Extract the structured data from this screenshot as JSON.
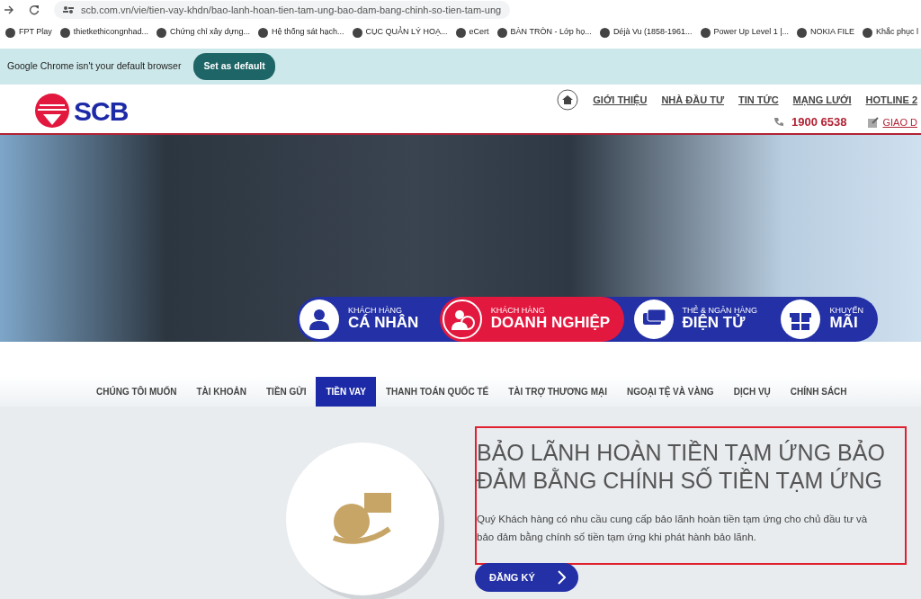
{
  "browser": {
    "url": "scb.com.vn/vie/tien-vay-khdn/bao-lanh-hoan-tien-tam-ung-bao-dam-bang-chinh-so-tien-tam-ung",
    "bookmarks": [
      "FPT Play",
      "thietkethicongnhad...",
      "Chứng chỉ xây dựng...",
      "Hệ thống sát hạch...",
      "CỤC QUẢN LÝ HOẠ...",
      "eCert",
      "BÀN TRÒN - Lớp họ...",
      "Déjà Vu (1858-1961...",
      "Power Up Level 1 |...",
      "NOKIA FILE",
      "Khắc phục l"
    ],
    "infobar": {
      "message": "Google Chrome isn't your default browser",
      "button": "Set as default"
    }
  },
  "header": {
    "logo": "SCB",
    "nav": [
      "GIỚI THIỆU",
      "NHÀ ĐẦU TƯ",
      "TIN TỨC",
      "MẠNG LƯỚI",
      "HOTLINE 2"
    ],
    "phone": "1900 6538",
    "link": "GIAO D"
  },
  "segments": [
    {
      "kind": "person",
      "small": "KHÁCH HÀNG",
      "big": "CÁ NHÂN",
      "selected": false
    },
    {
      "kind": "business",
      "small": "KHÁCH HÀNG",
      "big": "DOANH NGHIỆP",
      "selected": true
    },
    {
      "kind": "cards",
      "small": "THẺ & NGÂN HÀNG",
      "big": "ĐIỆN TỬ",
      "selected": false
    },
    {
      "kind": "gift",
      "small": "KHUYẾN",
      "big": "MÃI",
      "selected": false
    }
  ],
  "tabs": [
    {
      "label": "CHÚNG TÔI MUỐN",
      "selected": false
    },
    {
      "label": "TÀI KHOẢN",
      "selected": false
    },
    {
      "label": "TIỀN GỬI",
      "selected": false
    },
    {
      "label": "TIỀN VAY",
      "selected": true
    },
    {
      "label": "THANH TOÁN QUỐC TẾ",
      "selected": false
    },
    {
      "label": "TÀI TRỢ THƯƠNG MẠI",
      "selected": false
    },
    {
      "label": "NGOẠI TỆ VÀ VÀNG",
      "selected": false
    },
    {
      "label": "DỊCH VỤ",
      "selected": false
    },
    {
      "label": "CHÍNH SÁCH",
      "selected": false
    }
  ],
  "content": {
    "title": "BẢO LÃNH HOÀN TIỀN TẠM ỨNG BẢO ĐẢM BẰNG CHÍNH SỐ TIỀN TẠM ỨNG",
    "text": "Quý Khách hàng có nhu cầu cung cấp bảo lãnh hoàn tiền tạm ứng cho chủ đầu tư và bảo đảm bằng chính số tiền tạm ứng khi phát hành bảo lãnh.",
    "button": "ĐĂNG KÝ"
  }
}
